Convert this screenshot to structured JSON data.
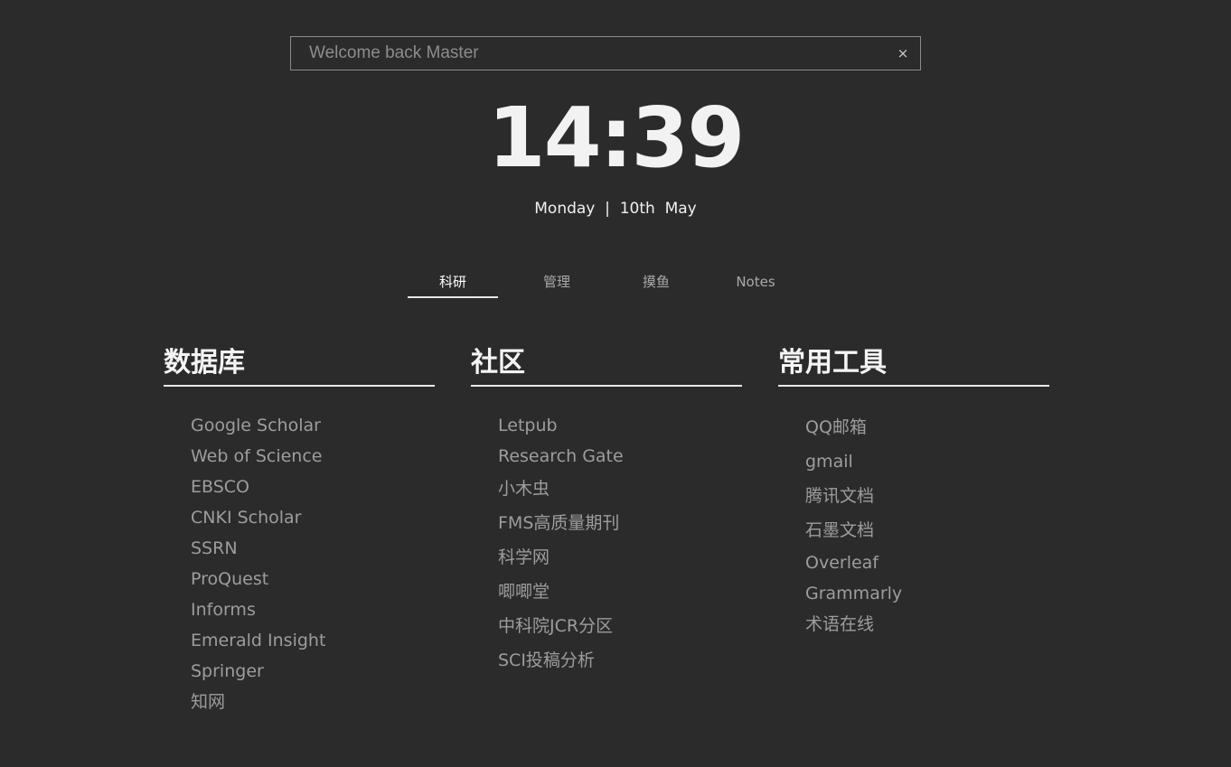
{
  "search": {
    "placeholder": "Welcome back Master",
    "clear_label": "×"
  },
  "clock": {
    "time": "14:39",
    "date": "Monday  |  10th  May"
  },
  "tabs": [
    {
      "label": "科研",
      "active": true
    },
    {
      "label": "管理",
      "active": false
    },
    {
      "label": "摸鱼",
      "active": false
    },
    {
      "label": "Notes",
      "active": false
    }
  ],
  "columns": [
    {
      "title": "数据库",
      "links": [
        "Google Scholar",
        "Web of Science",
        "EBSCO",
        "CNKI Scholar",
        "SSRN",
        "ProQuest",
        "Informs",
        "Emerald Insight",
        "Springer",
        "知网"
      ]
    },
    {
      "title": "社区",
      "links": [
        "Letpub",
        "Research Gate",
        "小木虫",
        "FMS高质量期刊",
        "科学网",
        "唧唧堂",
        "中科院JCR分区",
        "SCI投稿分析"
      ]
    },
    {
      "title": "常用工具",
      "links": [
        "QQ邮箱",
        "gmail",
        "腾讯文档",
        "石墨文档",
        "Overleaf",
        "Grammarly",
        "术语在线"
      ]
    }
  ],
  "colors": {
    "background": "#2b2b2b",
    "link": "#9d9d9d",
    "heading": "#f4f4f4"
  }
}
